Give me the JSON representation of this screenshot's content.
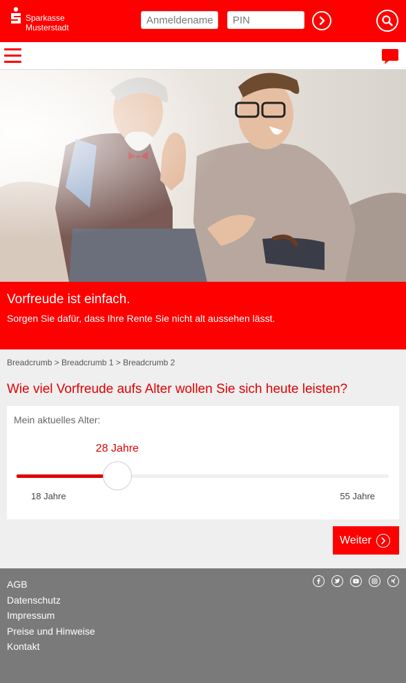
{
  "header": {
    "brand_line1": "Sparkasse",
    "brand_line2": "Musterstadt",
    "username_placeholder": "Anmeldename",
    "pin_placeholder": "PIN",
    "brand_color": "#ff0000"
  },
  "hero": {
    "title": "Vorfreude ist einfach.",
    "subtitle": "Sorgen Sie dafür, dass Ihre Rente Sie nicht alt aussehen lässt."
  },
  "breadcrumb": "Breadcrumb > Breadcrumb 1 > Breadcrumb 2",
  "calculator": {
    "question": "Wie viel Vorfreude aufs Alter wollen Sie sich heute leisten?",
    "age_label": "Mein aktuelles Alter:",
    "current_value": "28 Jahre",
    "min_label": "18 Jahre",
    "max_label": "55 Jahre",
    "min": 18,
    "max": 55,
    "value": 28
  },
  "actions": {
    "next_label": "Weiter"
  },
  "footer": {
    "links": [
      "AGB",
      "Datenschutz",
      "Impressum",
      "Preise und Hinweise",
      "Kontakt"
    ],
    "social_icons": [
      "facebook-icon",
      "twitter-icon",
      "youtube-icon",
      "instagram-icon",
      "xing-icon"
    ]
  }
}
